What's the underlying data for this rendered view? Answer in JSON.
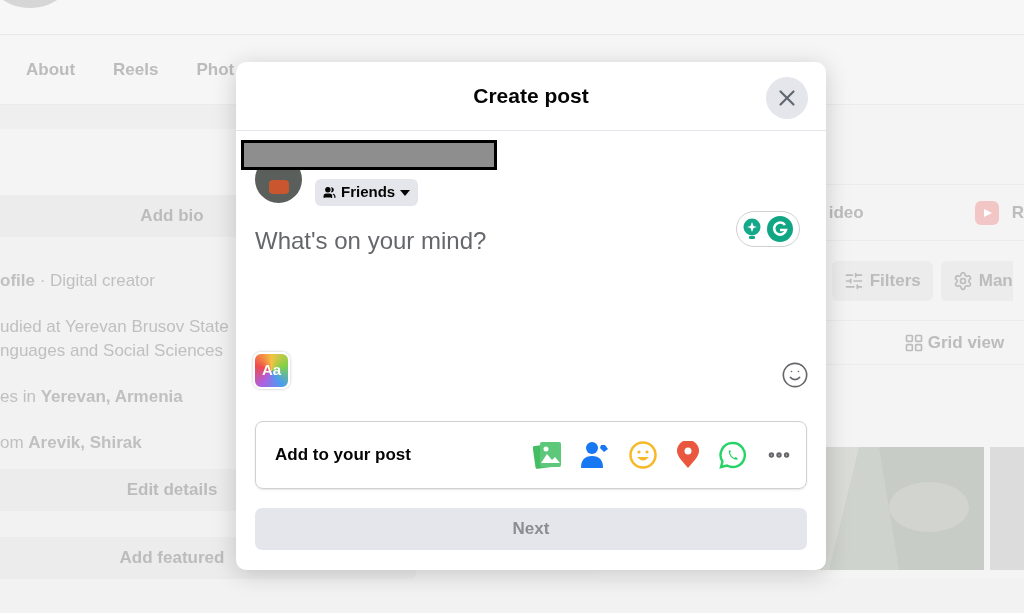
{
  "profile": {
    "tabs": [
      {
        "label": "About"
      },
      {
        "label": "Reels"
      },
      {
        "label": "Phot"
      }
    ],
    "intro": {
      "add_bio": "Add bio",
      "lines": [
        "**ofile** · Digital creator",
        "udied at Yerevan Brusov State\nnguages and Social Sciences",
        "es in **Yerevan, Armenia**",
        "om **Arevik, Shirak**"
      ],
      "edit_details": "Edit details",
      "add_featured": "Add featured"
    },
    "composer_options": [
      {
        "kind": "text",
        "label": "ideo"
      },
      {
        "kind": "reel",
        "label": "R"
      }
    ],
    "posts_toolbar": {
      "filters": "Filters",
      "manage": "Man",
      "grid_view": "Grid view"
    }
  },
  "dialog": {
    "title": "Create post",
    "audience": "Friends",
    "placeholder": "What's on your mind?",
    "text_style": "Aa",
    "add_to_post": "Add to your post",
    "next": {
      "label": "Next",
      "disabled": true
    }
  }
}
